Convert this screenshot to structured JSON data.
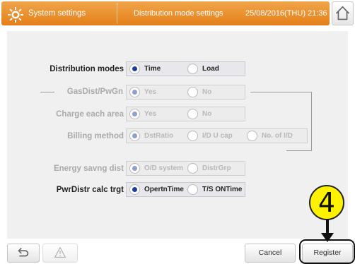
{
  "titlebar": {
    "app_title": "System settings",
    "screen_title": "Distribution mode settings",
    "datetime": "25/08/2016(THU) 21:36",
    "icons": {
      "settings": "sun-gear-icon",
      "home": "home-icon"
    }
  },
  "settings": {
    "distribution_modes": {
      "label": "Distribution modes",
      "options": [
        "Time",
        "Load"
      ],
      "selected": "Time"
    },
    "group_title": "GasDist/PwGn",
    "gasdist_pwgn": {
      "options": [
        "Yes",
        "No"
      ],
      "selected": "Yes"
    },
    "charge_each_area": {
      "label": "Charge each area",
      "options": [
        "Yes",
        "No"
      ],
      "selected": "Yes"
    },
    "billing_method": {
      "label": "Billing method",
      "options": [
        "DstRatio",
        "I/D U cap",
        "No. of I/D"
      ],
      "selected": "DstRatio"
    },
    "energy_savng_dist": {
      "label": "Energy savng dist",
      "options": [
        "O/D system",
        "DistrGrp"
      ],
      "selected": "O/D system"
    },
    "pwrdistr_calc_trgt": {
      "label": "PwrDistr calc trgt",
      "options": [
        "OpertnTime",
        "T/S ONTime"
      ],
      "selected": "OpertnTime"
    }
  },
  "footer": {
    "back_icon": "return-icon",
    "warning_icon": "warning-triangle-icon",
    "cancel_label": "Cancel",
    "register_label": "Register"
  },
  "callout": {
    "step_number": "4"
  },
  "colors": {
    "title_orange": "#e88a25",
    "radio_selected": "#1f3e9c",
    "callout_yellow": "#fff200"
  }
}
